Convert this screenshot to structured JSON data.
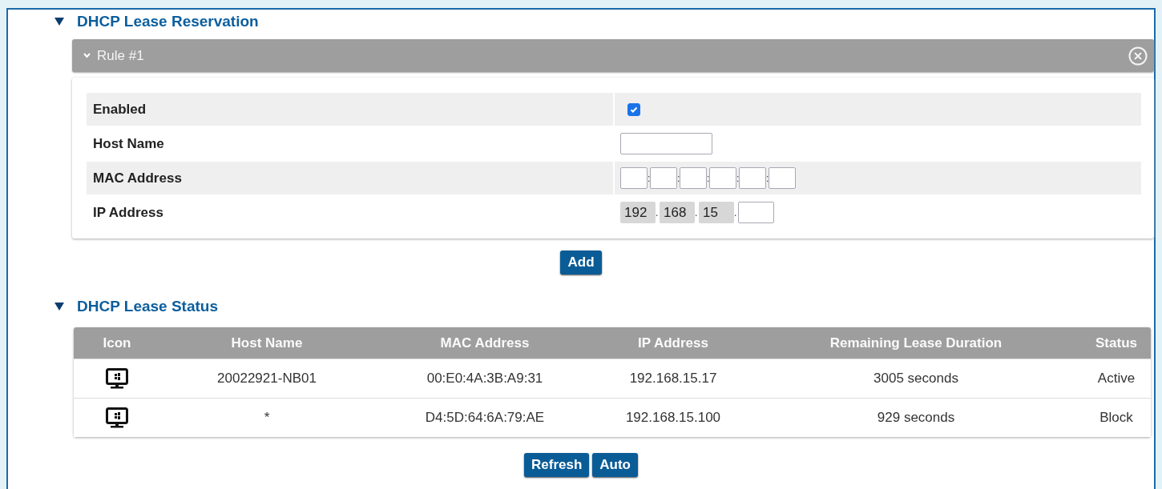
{
  "reservation": {
    "title": "DHCP Lease Reservation",
    "expanded": true,
    "rule": {
      "title": "Rule #1",
      "expanded": true,
      "fields": [
        {
          "kind": "checkbox",
          "label": "Enabled",
          "checked": true
        },
        {
          "kind": "text",
          "label": "Host Name"
        },
        {
          "kind": "mac",
          "label": "MAC Address",
          "parts": [
            {
              "disabled": false
            },
            {
              "separator": ":",
              "disabled": false
            },
            {
              "separator": ":",
              "disabled": false
            },
            {
              "separator": ":",
              "disabled": false
            },
            {
              "separator": ":",
              "disabled": false
            },
            {
              "separator": ":",
              "disabled": false
            }
          ]
        },
        {
          "kind": "ip",
          "label": "IP Address",
          "parts": [
            {
              "value": "192",
              "disabled": true
            },
            {
              "separator": ".",
              "value": "168",
              "disabled": true
            },
            {
              "separator": ".",
              "value": "15",
              "disabled": true
            },
            {
              "separator": ".",
              "disabled": false
            }
          ]
        }
      ]
    },
    "buttons": [
      "Add"
    ]
  },
  "status": {
    "title": "DHCP Lease Status",
    "expanded": true,
    "columns": [
      "Icon",
      "Host Name",
      "MAC Address",
      "IP Address",
      "Remaining Lease Duration",
      "Status"
    ],
    "rows": [
      {
        "host": "20022921-NB01",
        "mac": "00:E0:4A:3B:A9:31",
        "ip": "192.168.15.17",
        "remaining": "3005 seconds",
        "status": "Active"
      },
      {
        "host": "*",
        "mac": "D4:5D:64:6A:79:AE",
        "ip": "192.168.15.100",
        "remaining": "929 seconds",
        "status": "Block"
      }
    ],
    "buttons": [
      "Refresh",
      "Auto"
    ]
  }
}
